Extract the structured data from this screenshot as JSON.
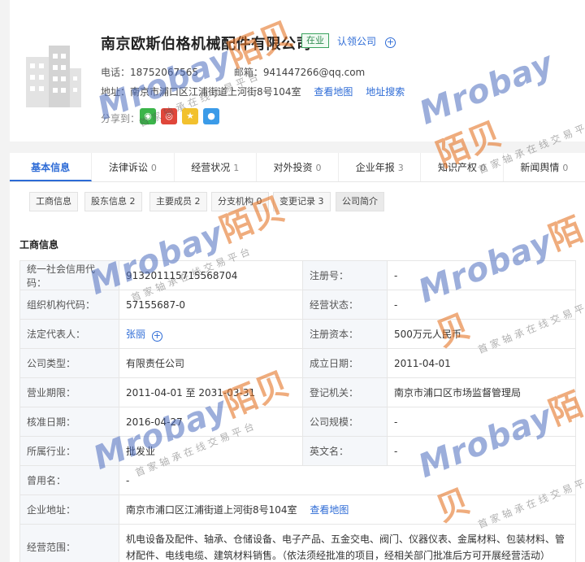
{
  "company": {
    "name": "南京欧斯伯格机械配件有限公司",
    "status": "在业",
    "claim": "认领公司",
    "phone_label": "电话：",
    "phone": "18752067565",
    "email_label": "邮箱：",
    "email": "941447266@qq.com",
    "address_label": "地址：",
    "address": "南京市浦口区江浦街道上河街8号104室",
    "view_map": "查看地图",
    "search_address": "地址搜索",
    "share_label": "分享到："
  },
  "tabs": [
    {
      "label": "基本信息",
      "count": ""
    },
    {
      "label": "法律诉讼",
      "count": "0"
    },
    {
      "label": "经营状况",
      "count": "1"
    },
    {
      "label": "对外投资",
      "count": "0"
    },
    {
      "label": "企业年报",
      "count": "3"
    },
    {
      "label": "知识产权",
      "count": "0"
    },
    {
      "label": "新闻舆情",
      "count": "0"
    }
  ],
  "subtabs": [
    "工商信息",
    "股东信息 2",
    "主要成员 2",
    "分支机构 0",
    "变更记录 3",
    "公司简介"
  ],
  "section_title": "工商信息",
  "fields": {
    "credit_code_k": "统一社会信用代码：",
    "credit_code_v": "913201115715568704",
    "reg_no_k": "注册号：",
    "reg_no_v": "-",
    "org_code_k": "组织机构代码：",
    "org_code_v": "57155687-0",
    "op_status_k": "经营状态：",
    "op_status_v": "-",
    "legal_rep_k": "法定代表人：",
    "legal_rep_v": "张丽",
    "reg_capital_k": "注册资本：",
    "reg_capital_v": "500万元人民币",
    "type_k": "公司类型：",
    "type_v": "有限责任公司",
    "est_date_k": "成立日期：",
    "est_date_v": "2011-04-01",
    "term_k": "营业期限：",
    "term_v": "2011-04-01 至 2031-03-31",
    "authority_k": "登记机关：",
    "authority_v": "南京市浦口区市场监督管理局",
    "approve_k": "核准日期：",
    "approve_v": "2016-04-27",
    "scale_k": "公司规模：",
    "scale_v": "-",
    "industry_k": "所属行业：",
    "industry_v": "批发业",
    "en_name_k": "英文名：",
    "en_name_v": "-",
    "former_k": "曾用名：",
    "former_v": "-",
    "addr_k": "企业地址：",
    "addr_v": "南京市浦口区江浦街道上河街8号104室",
    "addr_map": "查看地图",
    "scope_k": "经营范围：",
    "scope_v": "机电设备及配件、轴承、仓储设备、电子产品、五金交电、阀门、仪器仪表、金属材料、包装材料、管材配件、电线电缆、建筑材料销售。（依法须经批准的项目，经相关部门批准后方可开展经营活动）"
  },
  "watermark": {
    "brand": "Mrobay",
    "brand_cn": "陌贝",
    "slogan": "首家轴承在线交易平台"
  },
  "colors": {
    "accent": "#2d6bd6",
    "status": "#2e8b4f"
  }
}
